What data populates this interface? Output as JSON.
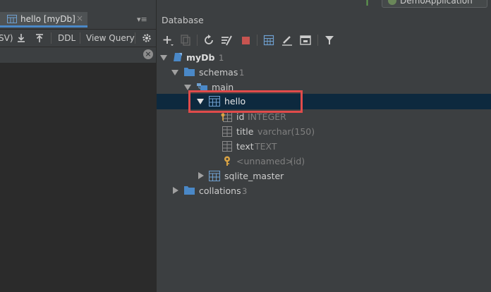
{
  "editor_tab": {
    "title": "hello [myDb]",
    "close": "×"
  },
  "editor_toolbar": {
    "partial_label": "SV)",
    "ddl_label": "DDL",
    "view_query_label": "View Query"
  },
  "run_config": {
    "label": "DemoApplication"
  },
  "database_panel": {
    "title": "Database",
    "tree": {
      "root": {
        "name": "myDb",
        "count": "1"
      },
      "schemas": {
        "name": "schemas",
        "count": "1"
      },
      "schema_main": {
        "name": "main"
      },
      "table_hello": {
        "name": "hello"
      },
      "columns": [
        {
          "name": "id",
          "type": "INTEGER"
        },
        {
          "name": "title",
          "type": "varchar(150)"
        },
        {
          "name": "text",
          "type": "TEXT"
        }
      ],
      "index": {
        "name": "<unnamed>",
        "detail": "(id)"
      },
      "table_sqlite_master": {
        "name": "sqlite_master"
      },
      "collations": {
        "name": "collations",
        "count": "3"
      }
    }
  },
  "colors": {
    "highlight_border": "#e04b4b",
    "selection_bg": "#0d293e",
    "accent": "#4a88c7"
  }
}
